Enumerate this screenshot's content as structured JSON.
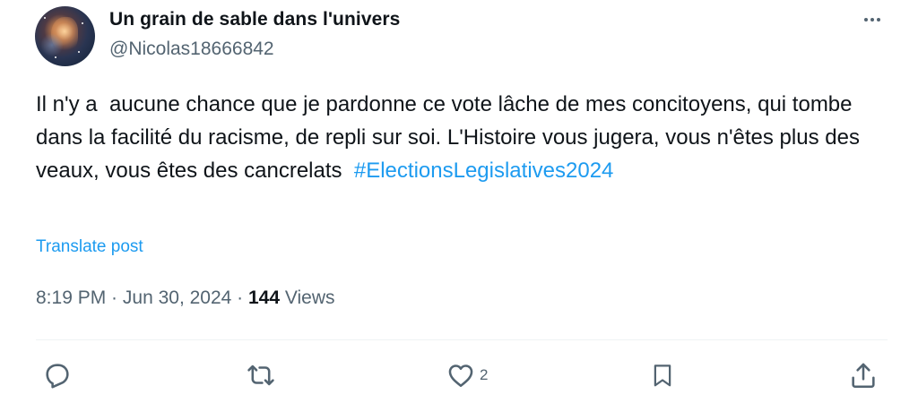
{
  "author": {
    "display_name": "Un grain de sable dans l'univers",
    "handle": "@Nicolas18666842"
  },
  "tweet": {
    "text": "Il n'y a  aucune chance que je pardonne ce vote lâche de mes concitoyens, qui tombe dans la facilité du racisme, de repli sur soi. L'Histoire vous jugera, vous n'êtes plus des veaux, vous êtes des cancrelats  ",
    "hashtag": "#ElectionsLegislatives2024",
    "translate_label": "Translate post"
  },
  "meta": {
    "time": "8:19 PM",
    "date": "Jun 30, 2024",
    "separator": " · ",
    "views_count": "144",
    "views_label": "Views"
  },
  "actions": {
    "reply_icon": "reply-icon",
    "repost_icon": "repost-icon",
    "like_icon": "heart-icon",
    "like_count": "2",
    "bookmark_icon": "bookmark-icon",
    "share_icon": "share-icon",
    "more_icon": "more-dots-icon"
  },
  "colors": {
    "link": "#1d9bf0",
    "secondary_text": "#536471",
    "primary_text": "#0f1419"
  }
}
